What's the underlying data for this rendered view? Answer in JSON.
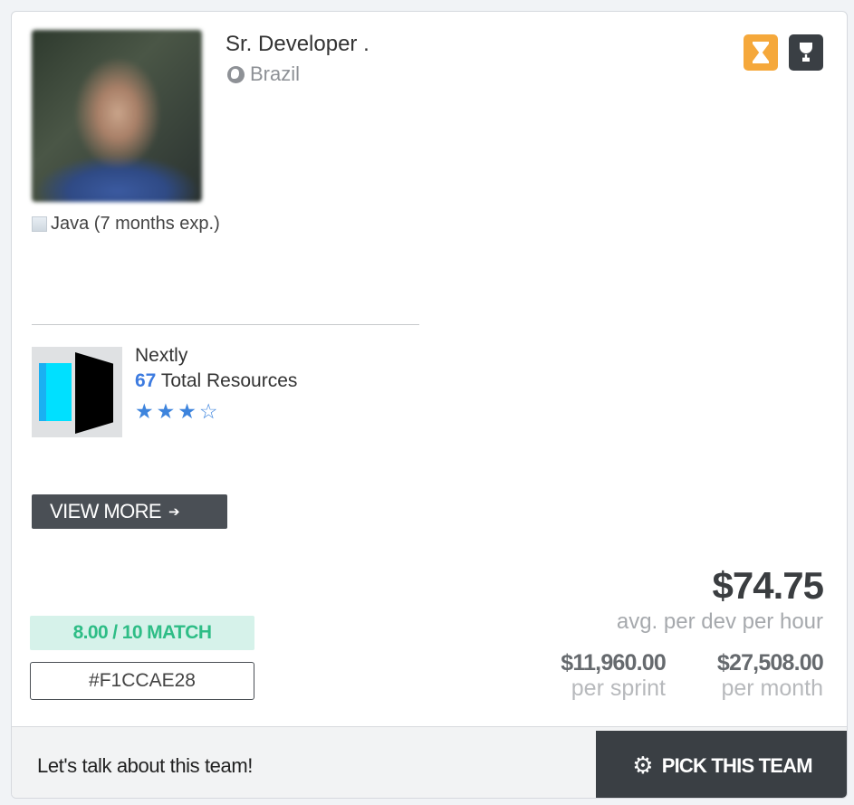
{
  "profile": {
    "role": "Sr. Developer .",
    "country": "Brazil",
    "skill": "Java (7 months exp.)"
  },
  "badges": [
    {
      "icon": "hourglass-icon",
      "color": "#f5a83b"
    },
    {
      "icon": "trophy-icon",
      "color": "#3a3f44"
    }
  ],
  "company": {
    "name": "Nextly",
    "resources_count": "67",
    "resources_label": "Total Resources",
    "rating": 3,
    "rating_max": 4
  },
  "view_more_label": "VIEW MORE",
  "match_label": "8.00 / 10 MATCH",
  "team_code": "#F1CCAE28",
  "pricing": {
    "avg_rate": "$74.75",
    "avg_rate_label": "avg. per dev per hour",
    "sprint_price": "$11,960.00",
    "sprint_label": "per sprint",
    "month_price": "$27,508.00",
    "month_label": "per month"
  },
  "footer": {
    "talk_label": "Let's talk about this team!",
    "pick_label": "PICK THIS TEAM"
  },
  "colors": {
    "accent_blue": "#3d7be0",
    "match_green": "#2ebd86",
    "dark_button": "#3a3f44"
  }
}
